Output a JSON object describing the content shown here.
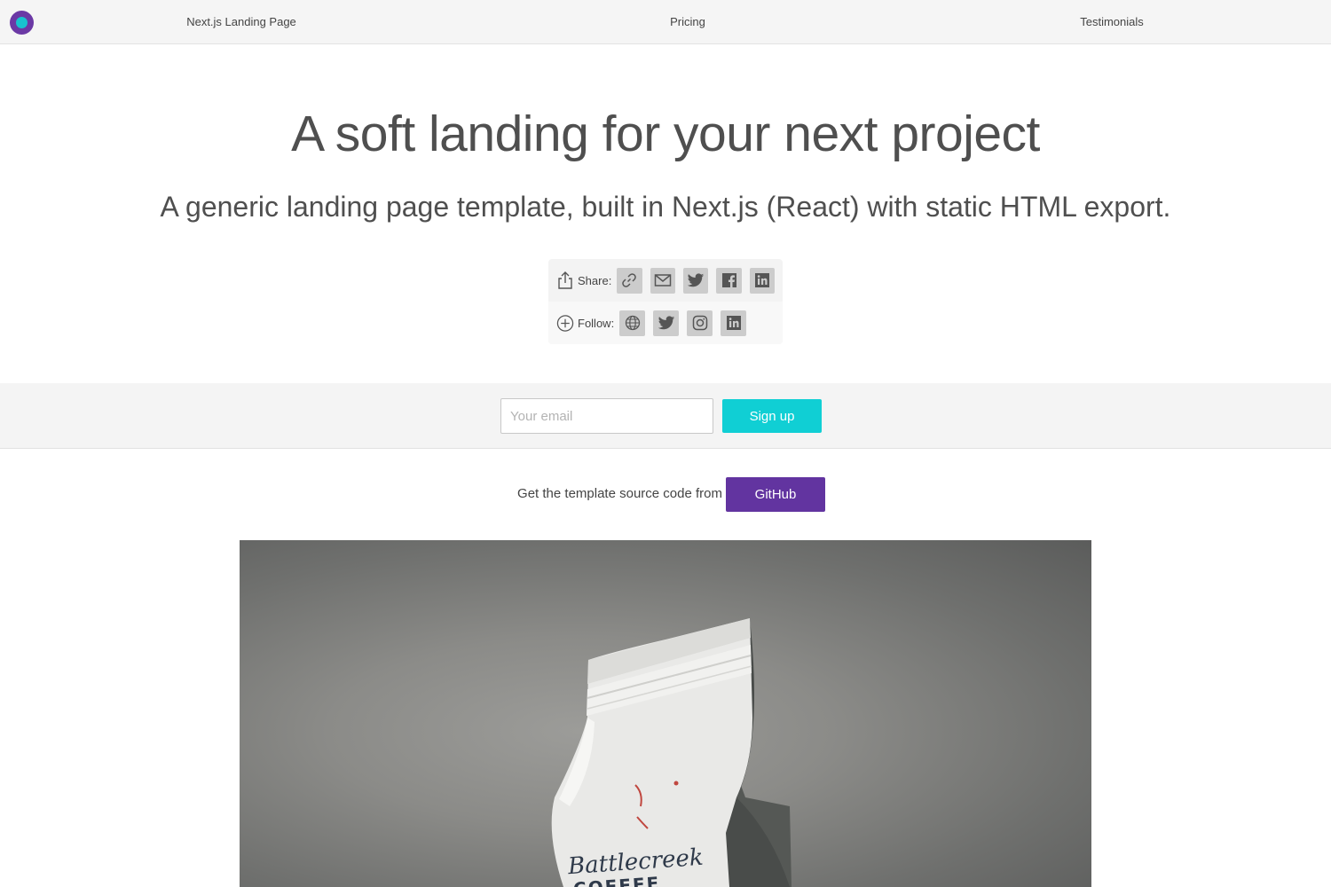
{
  "nav": {
    "logo_icon": "logo-circle-icon",
    "links": [
      "Next.js Landing Page",
      "Pricing",
      "Testimonials"
    ]
  },
  "hero": {
    "title": "A soft landing for your next project",
    "subtitle": "A generic landing page template, built in Next.js (React) with static HTML export."
  },
  "share": {
    "label": "Share:",
    "icon": "share-icon",
    "buttons": [
      "link-icon",
      "email-icon",
      "twitter-icon",
      "facebook-icon",
      "linkedin-icon"
    ]
  },
  "follow": {
    "label": "Follow:",
    "icon": "plus-circle-icon",
    "buttons": [
      "globe-icon",
      "twitter-icon",
      "instagram-icon",
      "linkedin-icon"
    ]
  },
  "signup": {
    "email_placeholder": "Your email",
    "button_label": "Sign up"
  },
  "source": {
    "text": "Get the template source code from",
    "button_label": "GitHub"
  },
  "photo": {
    "bag_text_line1": "Battlecreek",
    "bag_text_line2": "COFFEE"
  },
  "colors": {
    "accent_cyan": "#10cfd4",
    "accent_purple": "#6234a0",
    "text": "#4f4f4f"
  }
}
